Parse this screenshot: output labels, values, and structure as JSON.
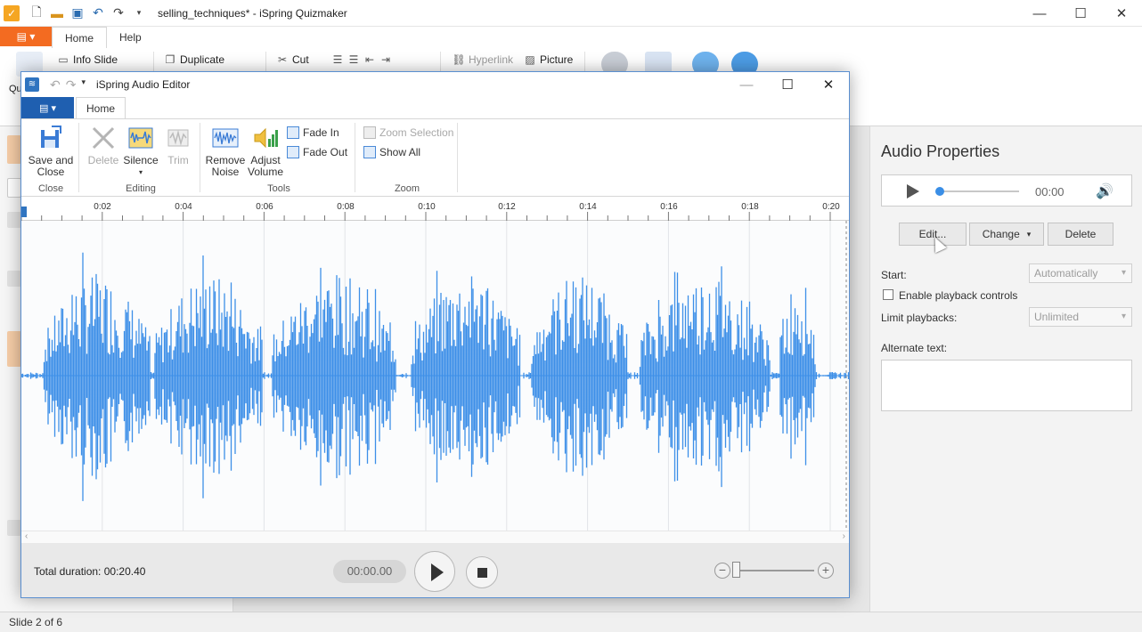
{
  "app": {
    "title": "selling_techniques* - iSpring Quizmaker",
    "tabs": [
      "Home",
      "Help"
    ],
    "file_menu_icon": "menu-icon",
    "ribbon": {
      "info_slide": "Info Slide",
      "duplicate": "Duplicate",
      "cut": "Cut",
      "hyperlink": "Hyperlink",
      "picture": "Picture",
      "left_label": "Qu"
    }
  },
  "editor": {
    "title": "iSpring Audio Editor",
    "tab": "Home",
    "groups": [
      "Close",
      "Editing",
      "Tools",
      "Zoom"
    ],
    "buttons": {
      "save_close": "Save and Close",
      "delete": "Delete",
      "silence": "Silence",
      "trim": "Trim",
      "remove_noise": "Remove Noise",
      "adjust_volume": "Adjust Volume",
      "fade_in": "Fade In",
      "fade_out": "Fade Out",
      "zoom_selection": "Zoom Selection",
      "show_all": "Show All"
    },
    "timeline_ticks": [
      "0:02",
      "0:04",
      "0:06",
      "0:08",
      "0:10",
      "0:12",
      "0:14",
      "0:16",
      "0:18",
      "0:20"
    ],
    "total_duration_label": "Total duration:",
    "total_duration": "00:20.40",
    "current_time": "00:00.00",
    "waveform_color": "#3d8fe8"
  },
  "props": {
    "title": "Audio Properties",
    "time": "00:00",
    "edit": "Edit...",
    "change": "Change",
    "delete": "Delete",
    "start_label": "Start:",
    "start_value": "Automatically",
    "enable_controls": "Enable playback controls",
    "limit_label": "Limit playbacks:",
    "limit_value": "Unlimited",
    "alt_label": "Alternate text:"
  },
  "status": "Slide 2 of 6"
}
